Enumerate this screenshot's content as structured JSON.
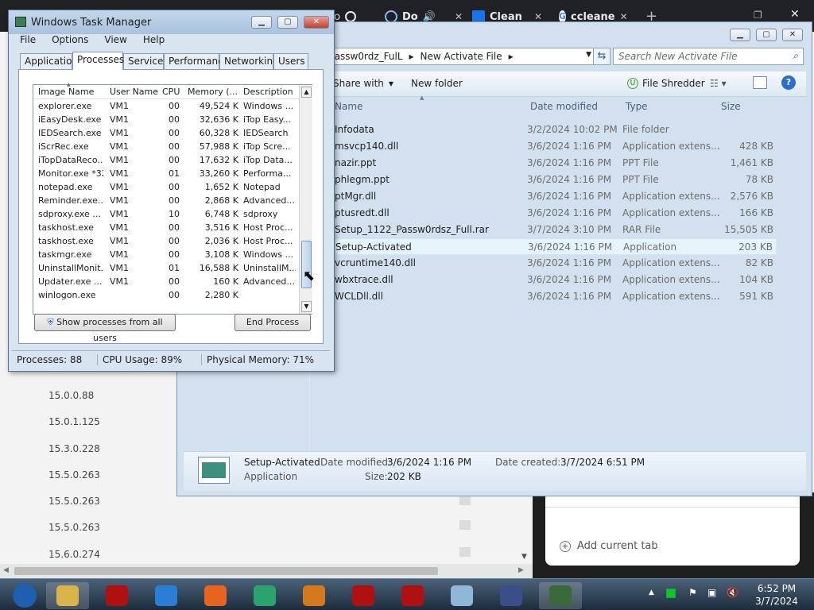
{
  "browser": {
    "tabs": [
      {
        "label": "to",
        "icon": "chrome-tab-icon"
      },
      {
        "label": "Do",
        "icon": "cortana-icon"
      },
      {
        "label": "Clean",
        "icon": "ccleaner-tab-icon"
      },
      {
        "label": "ccleane",
        "icon": "google-icon"
      }
    ],
    "versions": [
      "15.0.0.88",
      "15.0.1.125",
      "15.3.0.228",
      "15.5.0.263",
      "15.5.0.263",
      "15.5.0.263",
      "15.6.0.274"
    ],
    "add_tab_label": "Add current tab"
  },
  "explorer": {
    "address": {
      "crumb1": "Passw0rdz_FulL",
      "crumb2": "New Activate File"
    },
    "search_placeholder": "Search New Activate File",
    "toolbar": {
      "share": "Share with",
      "new_folder": "New folder",
      "shredder": "File Shredder"
    },
    "columns": {
      "name": "Name",
      "date": "Date modified",
      "type": "Type",
      "size": "Size"
    },
    "files": [
      {
        "name": "Infodata",
        "date": "3/2/2024 10:02 PM",
        "type": "File folder",
        "size": ""
      },
      {
        "name": "msvcp140.dll",
        "date": "3/6/2024 1:16 PM",
        "type": "Application extens...",
        "size": "428 KB"
      },
      {
        "name": "nazir.ppt",
        "date": "3/6/2024 1:16 PM",
        "type": "PPT File",
        "size": "1,461 KB"
      },
      {
        "name": "phlegm.ppt",
        "date": "3/6/2024 1:16 PM",
        "type": "PPT File",
        "size": "78 KB"
      },
      {
        "name": "ptMgr.dll",
        "date": "3/6/2024 1:16 PM",
        "type": "Application extens...",
        "size": "2,576 KB"
      },
      {
        "name": "ptusredt.dll",
        "date": "3/6/2024 1:16 PM",
        "type": "Application extens...",
        "size": "166 KB"
      },
      {
        "name": "Setup_1122_Passw0rdsz_Full.rar",
        "date": "3/7/2024 3:10 PM",
        "type": "RAR File",
        "size": "15,505 KB"
      },
      {
        "name": "Setup-Activated",
        "date": "3/6/2024 1:16 PM",
        "type": "Application",
        "size": "203 KB"
      },
      {
        "name": "vcruntime140.dll",
        "date": "3/6/2024 1:16 PM",
        "type": "Application extens...",
        "size": "82 KB"
      },
      {
        "name": "wbxtrace.dll",
        "date": "3/6/2024 1:16 PM",
        "type": "Application extens...",
        "size": "104 KB"
      },
      {
        "name": "WCLDll.dll",
        "date": "3/6/2024 1:16 PM",
        "type": "Application extens...",
        "size": "591 KB"
      }
    ],
    "details": {
      "name": "Setup-Activated",
      "kind": "Application",
      "modified_label": "Date modified:",
      "modified_value": "3/6/2024 1:16 PM",
      "created_label": "Date created:",
      "created_value": "3/7/2024 6:51 PM",
      "size_label": "Size:",
      "size_value": "202 KB"
    }
  },
  "taskmgr": {
    "title": "Windows Task Manager",
    "menu": [
      "File",
      "Options",
      "View",
      "Help"
    ],
    "tabs": [
      "Applications",
      "Processes",
      "Services",
      "Performance",
      "Networking",
      "Users"
    ],
    "active_tab": "Processes",
    "columns": {
      "image": "Image Name",
      "user": "User Name",
      "cpu": "CPU",
      "mem": "Memory (...",
      "desc": "Description"
    },
    "processes": [
      {
        "image": "explorer.exe",
        "user": "VM1",
        "cpu": "00",
        "mem": "49,524 K",
        "desc": "Windows ..."
      },
      {
        "image": "iEasyDesk.exe",
        "user": "VM1",
        "cpu": "00",
        "mem": "32,636 K",
        "desc": "iTop Easy..."
      },
      {
        "image": "IEDSearch.exe",
        "user": "VM1",
        "cpu": "00",
        "mem": "60,328 K",
        "desc": "IEDSearch"
      },
      {
        "image": "iScrRec.exe",
        "user": "VM1",
        "cpu": "00",
        "mem": "57,988 K",
        "desc": "iTop Scre..."
      },
      {
        "image": "iTopDataReco...",
        "user": "VM1",
        "cpu": "00",
        "mem": "17,632 K",
        "desc": "iTop Data..."
      },
      {
        "image": "Monitor.exe *32",
        "user": "VM1",
        "cpu": "01",
        "mem": "33,260 K",
        "desc": "Performa..."
      },
      {
        "image": "notepad.exe",
        "user": "VM1",
        "cpu": "00",
        "mem": "1,652 K",
        "desc": "Notepad"
      },
      {
        "image": "Reminder.exe...",
        "user": "VM1",
        "cpu": "00",
        "mem": "2,868 K",
        "desc": "Advanced..."
      },
      {
        "image": "sdproxy.exe ...",
        "user": "VM1",
        "cpu": "10",
        "mem": "6,748 K",
        "desc": "sdproxy"
      },
      {
        "image": "taskhost.exe",
        "user": "VM1",
        "cpu": "00",
        "mem": "3,516 K",
        "desc": "Host Proc..."
      },
      {
        "image": "taskhost.exe",
        "user": "VM1",
        "cpu": "00",
        "mem": "2,036 K",
        "desc": "Host Proc..."
      },
      {
        "image": "taskmgr.exe",
        "user": "VM1",
        "cpu": "00",
        "mem": "3,108 K",
        "desc": "Windows ..."
      },
      {
        "image": "UninstallMonit...",
        "user": "VM1",
        "cpu": "01",
        "mem": "16,588 K",
        "desc": "UninstallM..."
      },
      {
        "image": "Updater.exe ...",
        "user": "VM1",
        "cpu": "00",
        "mem": "160 K",
        "desc": "Advanced..."
      },
      {
        "image": "winlogon.exe",
        "user": "",
        "cpu": "00",
        "mem": "2,280 K",
        "desc": ""
      }
    ],
    "show_all_label": "Show processes from all users",
    "end_process_label": "End Process",
    "status": {
      "processes": "Processes: 88",
      "cpu": "CPU Usage: 89%",
      "memory": "Physical Memory: 71%"
    }
  },
  "taskbar": {
    "icons": [
      "start-orb-icon",
      "file-explorer-icon",
      "red-gear-app-icon",
      "internet-explorer-icon",
      "firefox-icon",
      "teal-app-icon",
      "media-player-icon",
      "screen-recorder-icon",
      "red-gear-app-icon",
      "notepad-icon",
      "settings-app-icon",
      "task-manager-icon"
    ],
    "time": "6:52 PM",
    "date": "3/7/2024"
  },
  "colors": {
    "selection": "#cce8ff",
    "titlebar": "#b9cde5",
    "taskbar": "#2a3b4d"
  }
}
